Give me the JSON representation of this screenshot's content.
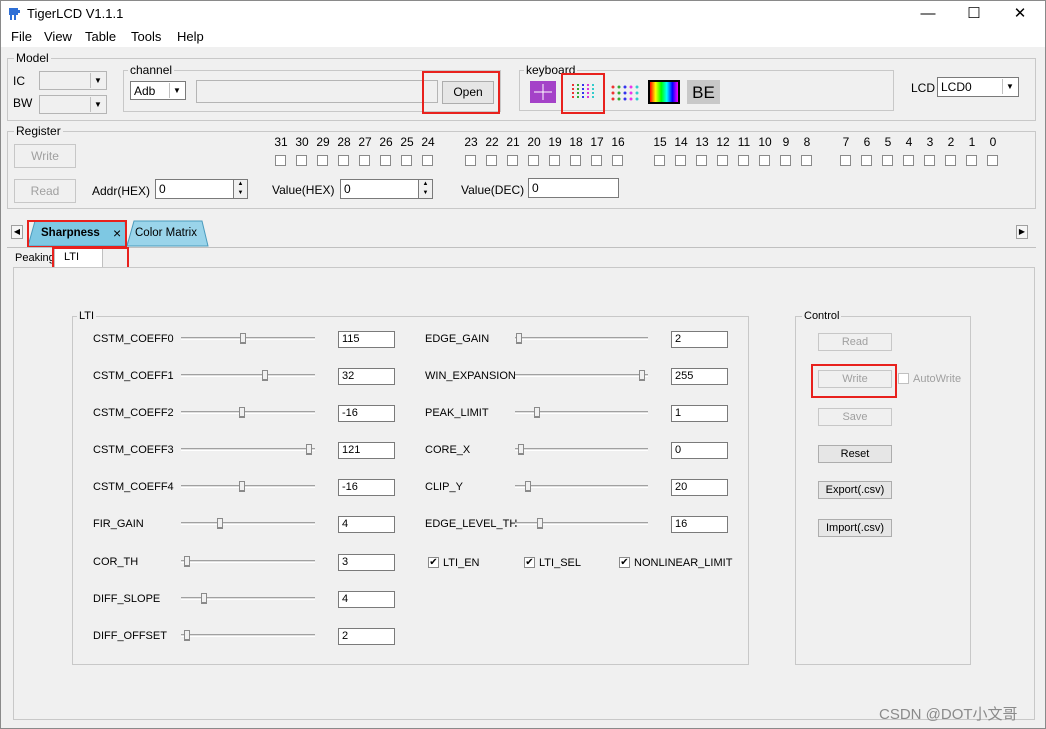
{
  "window": {
    "title": "TigerLCD V1.1.1",
    "min": "—",
    "max": "☐",
    "close": "✕"
  },
  "menu": [
    "File",
    "View",
    "Table",
    "Tools",
    "Help"
  ],
  "model": {
    "label": "Model",
    "ic_label": "IC",
    "bw_label": "BW"
  },
  "channel": {
    "label": "channel",
    "value": "Adb",
    "open_label": "Open"
  },
  "keyboard": {
    "label": "keyboard",
    "be_label": "BE"
  },
  "lcd": {
    "label": "LCD",
    "value": "LCD0"
  },
  "register": {
    "label": "Register",
    "write_label": "Write",
    "read_label": "Read",
    "addr_label": "Addr(HEX)",
    "addr_value": "0",
    "value_hex_label": "Value(HEX)",
    "value_hex": "0",
    "value_dec_label": "Value(DEC)",
    "value_dec": "0",
    "bits": [
      "31",
      "30",
      "29",
      "28",
      "27",
      "26",
      "25",
      "24",
      "23",
      "22",
      "21",
      "20",
      "19",
      "18",
      "17",
      "16",
      "15",
      "14",
      "13",
      "12",
      "11",
      "10",
      "9",
      "8",
      "7",
      "6",
      "5",
      "4",
      "3",
      "2",
      "1",
      "0"
    ]
  },
  "tabs": {
    "main": [
      "Sharpness",
      "Color Matrix"
    ],
    "close_glyph": "×",
    "sub": [
      "Peaking",
      "LTI"
    ]
  },
  "lti": {
    "label": "LTI",
    "left": [
      {
        "name": "CSTM_COEFF0",
        "value": "115",
        "pos": 0.46
      },
      {
        "name": "CSTM_COEFF1",
        "value": "32",
        "pos": 0.63
      },
      {
        "name": "CSTM_COEFF2",
        "value": "-16",
        "pos": 0.45
      },
      {
        "name": "CSTM_COEFF3",
        "value": "121",
        "pos": 0.98
      },
      {
        "name": "CSTM_COEFF4",
        "value": "-16",
        "pos": 0.45
      },
      {
        "name": "FIR_GAIN",
        "value": "4",
        "pos": 0.28
      },
      {
        "name": "COR_TH",
        "value": "3",
        "pos": 0.02
      },
      {
        "name": "DIFF_SLOPE",
        "value": "4",
        "pos": 0.16
      },
      {
        "name": "DIFF_OFFSET",
        "value": "2",
        "pos": 0.02
      }
    ],
    "right": [
      {
        "name": "EDGE_GAIN",
        "value": "2",
        "pos": 0.01
      },
      {
        "name": "WIN_EXPANSION",
        "value": "255",
        "pos": 0.98
      },
      {
        "name": "PEAK_LIMIT",
        "value": "1",
        "pos": 0.15
      },
      {
        "name": "CORE_X",
        "value": "0",
        "pos": 0.02
      },
      {
        "name": "CLIP_Y",
        "value": "20",
        "pos": 0.08
      },
      {
        "name": "EDGE_LEVEL_TH",
        "value": "16",
        "pos": 0.17
      }
    ],
    "checks": [
      {
        "name": "LTI_EN",
        "checked": true
      },
      {
        "name": "LTI_SEL",
        "checked": true
      },
      {
        "name": "NONLINEAR_LIMIT",
        "checked": true
      }
    ]
  },
  "control": {
    "label": "Control",
    "read": "Read",
    "write": "Write",
    "autowrite": "AutoWrite",
    "save": "Save",
    "reset": "Reset",
    "export": "Export(.csv)",
    "import": "Import(.csv)"
  },
  "watermark": "CSDN @DOT小文哥"
}
